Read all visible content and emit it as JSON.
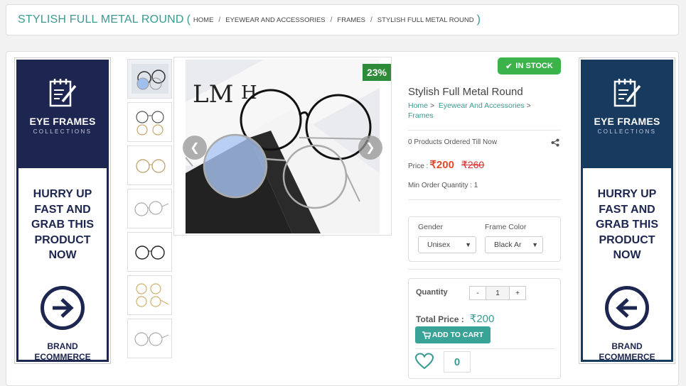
{
  "breadcrumb": {
    "title": "STYLISH FULL METAL ROUND",
    "open_paren": "(",
    "close_paren": ")",
    "items": [
      "HOME",
      "EYEWEAR AND ACCESSORIES",
      "FRAMES",
      "STYLISH FULL METAL ROUND"
    ],
    "separator": "/"
  },
  "banners": {
    "left": {
      "title": "EYE FRAMES",
      "subtitle": "COLLECTIONS",
      "hurry_lines": [
        "HURRY UP",
        "FAST AND",
        "GRAB THIS",
        "PRODUCT",
        "NOW"
      ],
      "arrow_icon": "arrow-right-icon",
      "brand_lines": [
        "BRAND",
        "ECOMMERCE"
      ],
      "color": "#1d2650"
    },
    "right": {
      "title": "EYE FRAMES",
      "subtitle": "COLLECTIONS",
      "hurry_lines": [
        "HURRY UP",
        "FAST AND",
        "GRAB THIS",
        "PRODUCT",
        "NOW"
      ],
      "arrow_icon": "arrow-left-icon",
      "brand_lines": [
        "BRAND",
        "ECOMMERCE"
      ],
      "color": "#173a5e"
    }
  },
  "gallery": {
    "discount": "23%",
    "prev_icon": "chevron-left-icon",
    "next_icon": "chevron-right-icon",
    "thumbnail_count": 7
  },
  "product": {
    "stock": "IN STOCK",
    "title": "Stylish Full Metal Round",
    "crumbs": [
      "Home",
      "Eyewear And Accessories",
      "Frames"
    ],
    "crumb_sep": ">",
    "ordered": "0 Products Ordered Till Now",
    "price_label": "Price :",
    "price": "₹200",
    "old_price": "₹260",
    "min_order": "Min Order Quantity : 1"
  },
  "options": {
    "gender_label": "Gender",
    "gender_value": "Unisex",
    "color_label": "Frame Color",
    "color_value": "Black Ar"
  },
  "cart": {
    "qty_label": "Quantity",
    "minus": "-",
    "qty": "1",
    "plus": "+",
    "total_label": "Total Price :",
    "total": "₹200",
    "add_label": "ADD TO CART",
    "likes": "0"
  },
  "colors": {
    "accent": "#3a9a91",
    "stock_green": "#3cb34a",
    "discount_green": "#2e8b3a",
    "price_red": "#e04a2f"
  }
}
